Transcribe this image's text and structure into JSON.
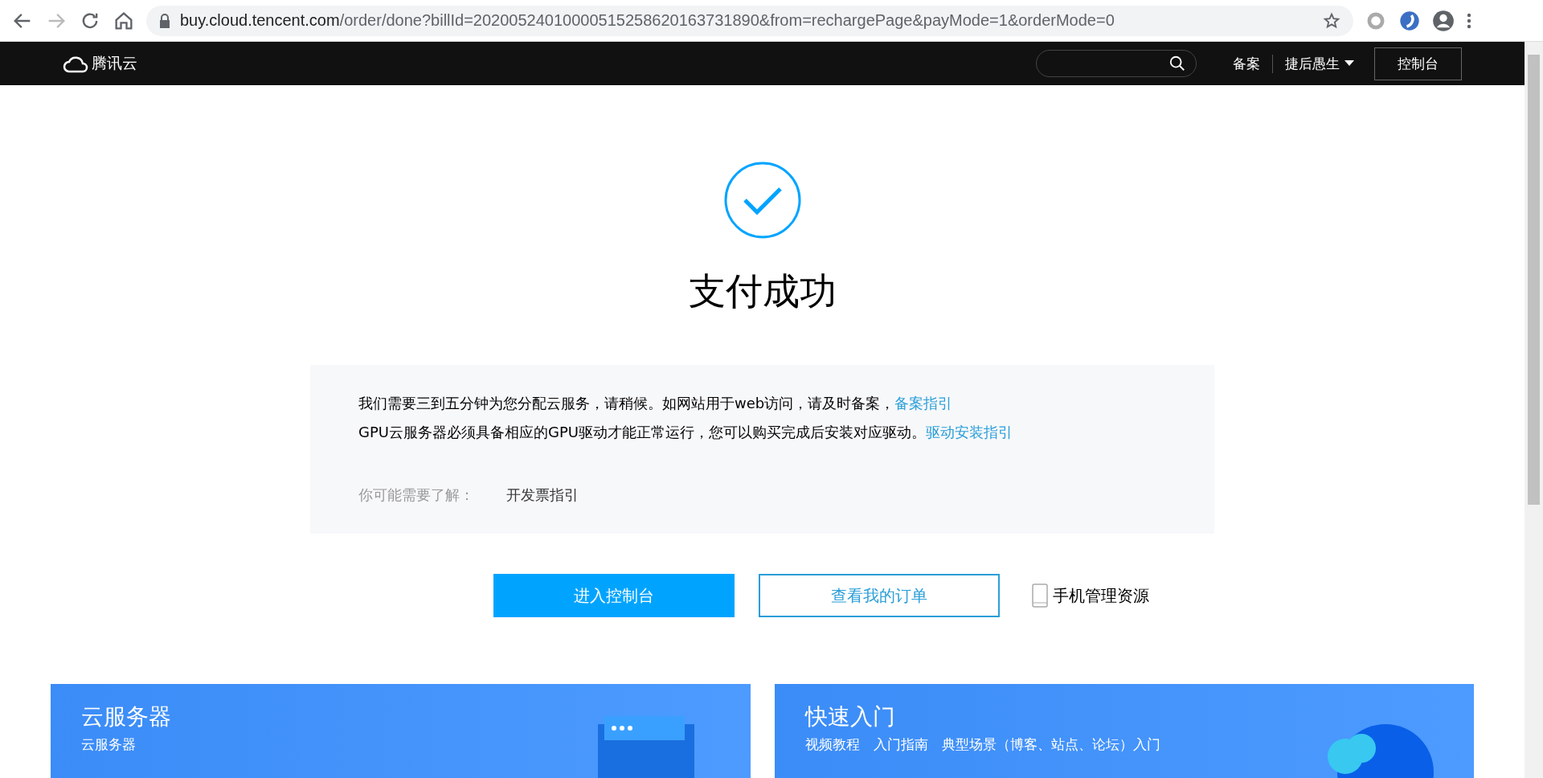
{
  "browser": {
    "url_host": "buy.cloud.tencent.com",
    "url_path": "/order/done?billId=20200524010000515258620163731890&from=rechargePage&payMode=1&orderMode=0"
  },
  "header": {
    "logo": "腾讯云",
    "nav": [
      {
        "label": "备案",
        "dropdown": false
      },
      {
        "label": "捷后愚生",
        "dropdown": true
      }
    ],
    "console_button": "控制台"
  },
  "result": {
    "title": "支付成功"
  },
  "notice": {
    "lines": [
      {
        "text": "我们需要三到五分钟为您分配云服务，请稍候。如网站用于web访问，请及时备案，",
        "link": "备案指引"
      },
      {
        "text": "GPU云服务器必须具备相应的GPU驱动才能正常运行，您可以购买完成后安装对应驱动。",
        "link": "驱动安装指引"
      }
    ],
    "more_label": "你可能需要了解：",
    "more_links": [
      "开发票指引"
    ]
  },
  "actions": {
    "primary": "进入控制台",
    "secondary": "查看我的订单",
    "mobile": "手机管理资源"
  },
  "cards": [
    {
      "kind": "server",
      "title": "云服务器",
      "subtitle": "云服务器"
    },
    {
      "kind": "cloud",
      "title": "快速入门",
      "subtitle": "视频教程　入门指南　典型场景（博客、站点、论坛）入门"
    }
  ]
}
